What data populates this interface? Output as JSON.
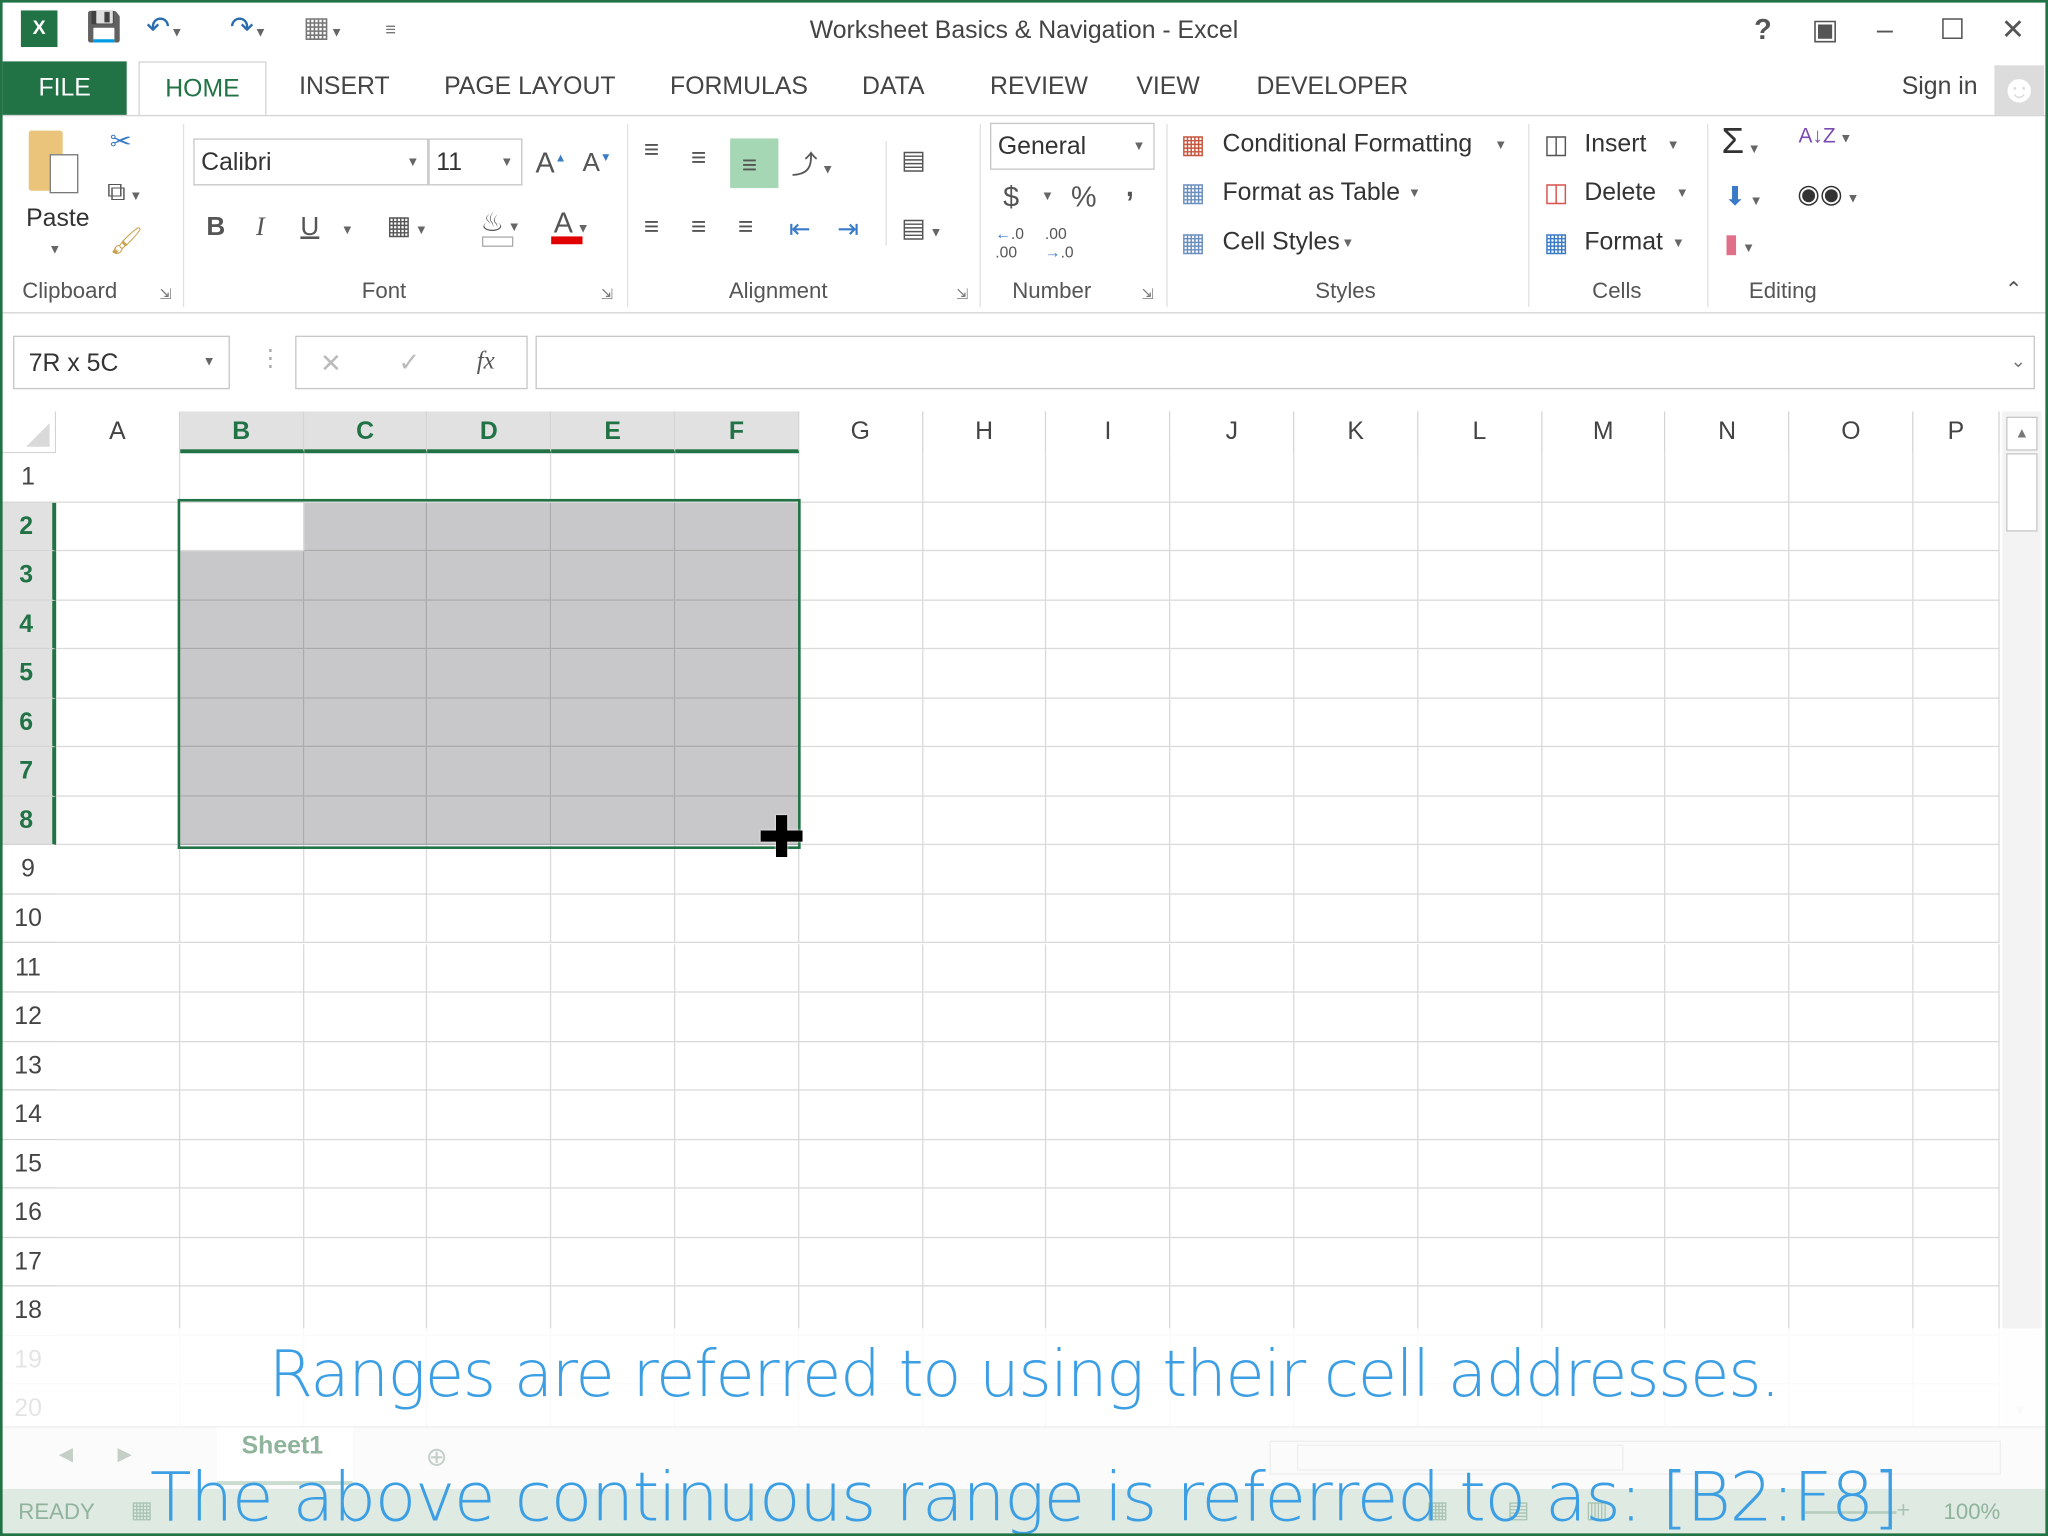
{
  "window": {
    "title": "Worksheet Basics & Navigation - Excel",
    "help": "?",
    "sign_in": "Sign in"
  },
  "tabs": [
    "FILE",
    "HOME",
    "INSERT",
    "PAGE LAYOUT",
    "FORMULAS",
    "DATA",
    "REVIEW",
    "VIEW",
    "DEVELOPER"
  ],
  "ribbon": {
    "clipboard": {
      "label": "Clipboard",
      "paste": "Paste"
    },
    "font": {
      "label": "Font",
      "name": "Calibri",
      "size": "11",
      "bold": "B",
      "italic": "I",
      "underline": "U"
    },
    "alignment": {
      "label": "Alignment"
    },
    "number": {
      "label": "Number",
      "format": "General",
      "currency": "$",
      "percent": "%",
      "comma": ","
    },
    "styles": {
      "label": "Styles",
      "conditional": "Conditional Formatting",
      "format_table": "Format as Table",
      "cell_styles": "Cell Styles"
    },
    "cells": {
      "label": "Cells",
      "insert": "Insert",
      "delete": "Delete",
      "format": "Format"
    },
    "editing": {
      "label": "Editing",
      "sum": "Σ"
    }
  },
  "formula_bar": {
    "name_box": "7R x 5C",
    "formula": "",
    "fx": "fx"
  },
  "grid": {
    "columns": [
      "A",
      "B",
      "C",
      "D",
      "E",
      "F",
      "G",
      "H",
      "I",
      "J",
      "K",
      "L",
      "M",
      "N",
      "O",
      "P"
    ],
    "rows": [
      "1",
      "2",
      "3",
      "4",
      "5",
      "6",
      "7",
      "8",
      "9",
      "10",
      "11",
      "12",
      "13",
      "14",
      "15",
      "16",
      "17",
      "18",
      "19",
      "20"
    ],
    "selection": {
      "range": "B2:F8",
      "active_cell": "B2"
    },
    "selection_color": "#c8c7c9",
    "accent": "#217346"
  },
  "sheet_tabs": [
    "Sheet1"
  ],
  "status": {
    "mode": "READY",
    "zoom": "100%"
  },
  "captions": [
    "Ranges are referred to using their cell addresses.",
    "The above continuous range is referred to as: [B2:F8]"
  ]
}
